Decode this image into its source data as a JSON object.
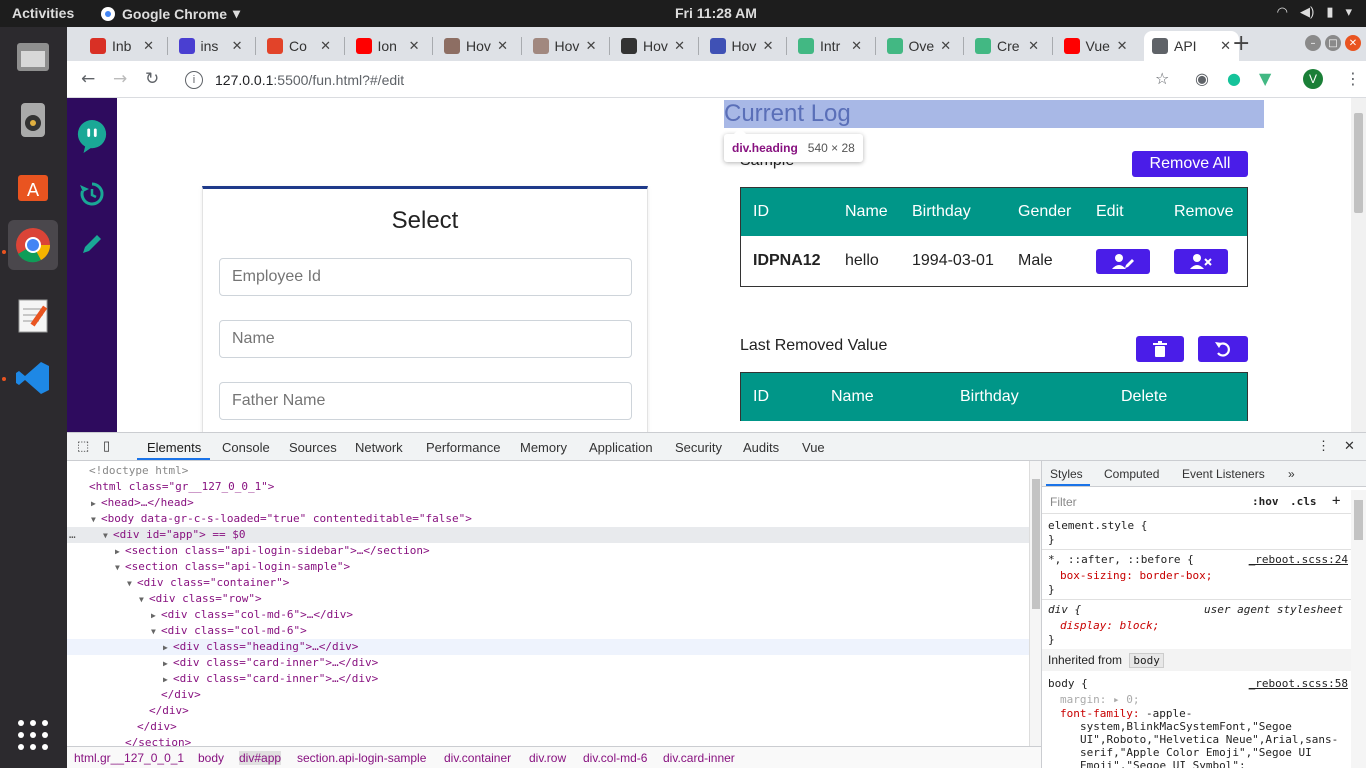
{
  "topbar": {
    "activities": "Activities",
    "app": "Google Chrome",
    "clock": "Fri 11:28 AM"
  },
  "tabs": [
    {
      "label": "Inb",
      "icon": "gmail-icon",
      "color": "#d93025"
    },
    {
      "label": "ins",
      "icon": "docs-icon",
      "color": "#4a3fd1"
    },
    {
      "label": "Co",
      "icon": "gitlab-icon",
      "color": "#e24329"
    },
    {
      "label": "Ion",
      "icon": "youtube-icon",
      "color": "#ff0000"
    },
    {
      "label": "Hov",
      "icon": "profile-icon",
      "color": "#8d6e63"
    },
    {
      "label": "Hov",
      "icon": "face-icon",
      "color": "#a1887f"
    },
    {
      "label": "Hov",
      "icon": "hex-icon",
      "color": "#333333"
    },
    {
      "label": "Hov",
      "icon": "circle-icon",
      "color": "#3f51b5"
    },
    {
      "label": "Intr",
      "icon": "vue-icon",
      "color": "#42b883"
    },
    {
      "label": "Ove",
      "icon": "vue-icon",
      "color": "#42b883"
    },
    {
      "label": "Cre",
      "icon": "vue-icon",
      "color": "#42b883"
    },
    {
      "label": "Vue",
      "icon": "youtube-icon",
      "color": "#ff0000"
    },
    {
      "label": "API",
      "icon": "globe-icon",
      "color": "#5f6368"
    }
  ],
  "omnibox": {
    "host": "127.0.0.1",
    "rest": ":5500/fun.html?#/edit"
  },
  "profile": {
    "initial": "V"
  },
  "page": {
    "select_title": "Select",
    "fields": {
      "employee_id": "Employee Id",
      "name": "Name",
      "father_name": "Father Name"
    },
    "log_heading": "Current Log",
    "inspect_tag": "div.heading",
    "inspect_size": "540 × 28",
    "sample_label": "Sample",
    "remove_all": "Remove All",
    "log_table": {
      "headers": [
        "ID",
        "Name",
        "Birthday",
        "Gender",
        "Edit",
        "Remove"
      ],
      "row": {
        "id": "IDPNA12",
        "name": "hello",
        "birthday": "1994-03-01",
        "gender": "Male"
      }
    },
    "last_removed": "Last Removed Value",
    "removed_table": {
      "headers": [
        "ID",
        "Name",
        "Birthday",
        "Delete"
      ]
    }
  },
  "colors": {
    "sidebar": "#2e0b5e",
    "teal": "#009688",
    "primary": "#4a1de8"
  },
  "devtools": {
    "tabs": [
      "Elements",
      "Console",
      "Sources",
      "Network",
      "Performance",
      "Memory",
      "Application",
      "Security",
      "Audits",
      "Vue"
    ],
    "lines": [
      "<!doctype html>",
      "<html class=\"gr__127_0_0_1\">",
      "<head>…</head>",
      "<body data-gr-c-s-loaded=\"true\" contenteditable=\"false\">",
      "<div id=\"app\"> == $0",
      "<section class=\"api-login-sidebar\">…</section>",
      "<section class=\"api-login-sample\">",
      "<div class=\"container\">",
      "<div class=\"row\">",
      "<div class=\"col-md-6\">…</div>",
      "<div class=\"col-md-6\">",
      "<div class=\"heading\">…</div>",
      "<div class=\"card-inner\">…</div>",
      "<div class=\"card-inner\">…</div>",
      "</div>",
      "</div>",
      "</div>",
      "</section>"
    ],
    "crumbs": [
      "html.gr__127_0_0_1",
      "body",
      "div#app",
      "section.api-login-sample",
      "div.container",
      "div.row",
      "div.col-md-6",
      "div.card-inner"
    ],
    "styles_tabs": [
      "Styles",
      "Computed",
      "Event Listeners"
    ],
    "filter_placeholder": "Filter",
    "hov": ":hov",
    "cls": ".cls",
    "rules": {
      "element_style": "element.style {",
      "universal_selector": "*, ::after, ::before {",
      "universal_src": "_reboot.scss:24",
      "box_sizing": "box-sizing: border-box;",
      "div_selector": "div {",
      "div_src": "user agent stylesheet",
      "display": "display: block;",
      "inherited": "Inherited from",
      "inherited_el": "body",
      "body_selector": "body {",
      "body_src": "_reboot.scss:58",
      "margin": "margin: ▸ 0;",
      "font_family_prop": "font-family:",
      "font_family_value": [
        "-apple-",
        "system,BlinkMacSystemFont,\"Segoe",
        "UI\",Roboto,\"Helvetica Neue\",Arial,sans-",
        "serif,\"Apple Color Emoji\",\"Segoe UI",
        "Emoji\",\"Segoe UI Symbol\";"
      ]
    }
  }
}
